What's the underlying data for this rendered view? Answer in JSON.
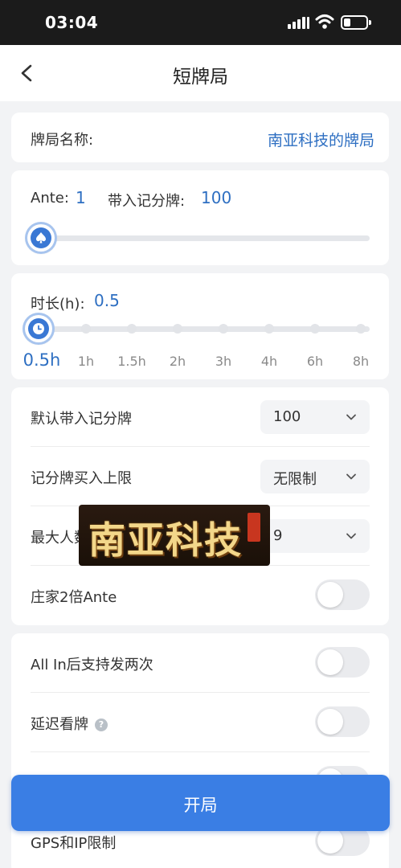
{
  "status_bar": {
    "time": "03:04"
  },
  "nav": {
    "title": "短牌局"
  },
  "table_name": {
    "label": "牌局名称:",
    "value": "南亚科技的牌局"
  },
  "ante": {
    "label": "Ante:",
    "value": "1",
    "buyin_label": "带入记分牌:",
    "buyin_value": "100",
    "level": 0
  },
  "duration": {
    "label": "时长(h):",
    "value": "0.5",
    "options": [
      "0.5h",
      "1h",
      "1.5h",
      "2h",
      "3h",
      "4h",
      "6h",
      "8h"
    ],
    "selected_index": 0
  },
  "settings": [
    {
      "label": "默认带入记分牌",
      "type": "select",
      "value": "100"
    },
    {
      "label": "记分牌买入上限",
      "type": "select",
      "value": "无限制"
    },
    {
      "label": "最大人数",
      "type": "select",
      "value": "9"
    },
    {
      "label": "庄家2倍Ante",
      "type": "toggle",
      "on": false
    }
  ],
  "advanced": [
    {
      "label": "All In后支持发两次",
      "type": "toggle",
      "on": false
    },
    {
      "label": "延迟看牌",
      "type": "toggle",
      "on": false,
      "help": true
    },
    {
      "label": "GPS和IP限制",
      "type": "toggle",
      "on": false
    }
  ],
  "watermark": {
    "text": "南亚科技"
  },
  "start_button": {
    "label": "开局"
  },
  "colors": {
    "accent": "#3a7ee4",
    "value_text": "#2e6fc2",
    "status_bar": "#1b1b1b"
  }
}
